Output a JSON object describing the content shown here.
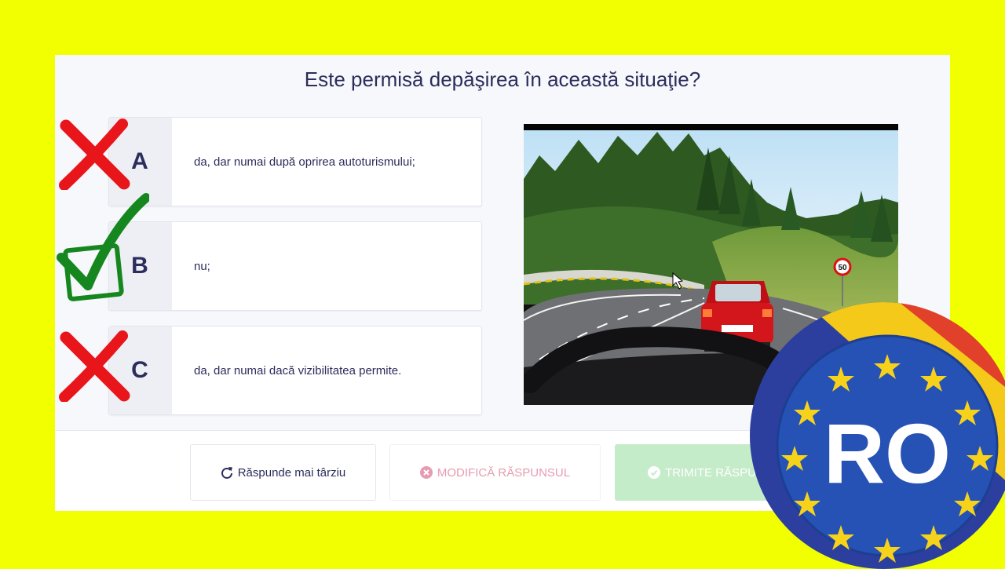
{
  "question": "Este permisă depăşirea în această situaţie?",
  "answers": [
    {
      "letter": "A",
      "text": "da, dar numai după oprirea autoturismului;",
      "mark": "wrong"
    },
    {
      "letter": "B",
      "text": "nu;",
      "mark": "correct"
    },
    {
      "letter": "C",
      "text": "da, dar numai dacă vizibilitatea permite.",
      "mark": "wrong"
    }
  ],
  "photo": {
    "speed_sign": "50"
  },
  "buttons": {
    "later": "Răspunde mai târziu",
    "modify": "MODIFICĂ RĂSPUNSUL",
    "submit": "TRIMITE RĂSPUNSUL"
  },
  "badge": {
    "label": "RO"
  },
  "colors": {
    "background": "#f2ff00",
    "wrong_mark": "#e8161b",
    "correct_mark": "#16871f",
    "modify_text": "#e79bb0",
    "submit_bg": "#c5ecc9"
  },
  "icons": {
    "later": "refresh-icon",
    "modify": "x-circle-icon",
    "submit": "check-circle-icon"
  }
}
